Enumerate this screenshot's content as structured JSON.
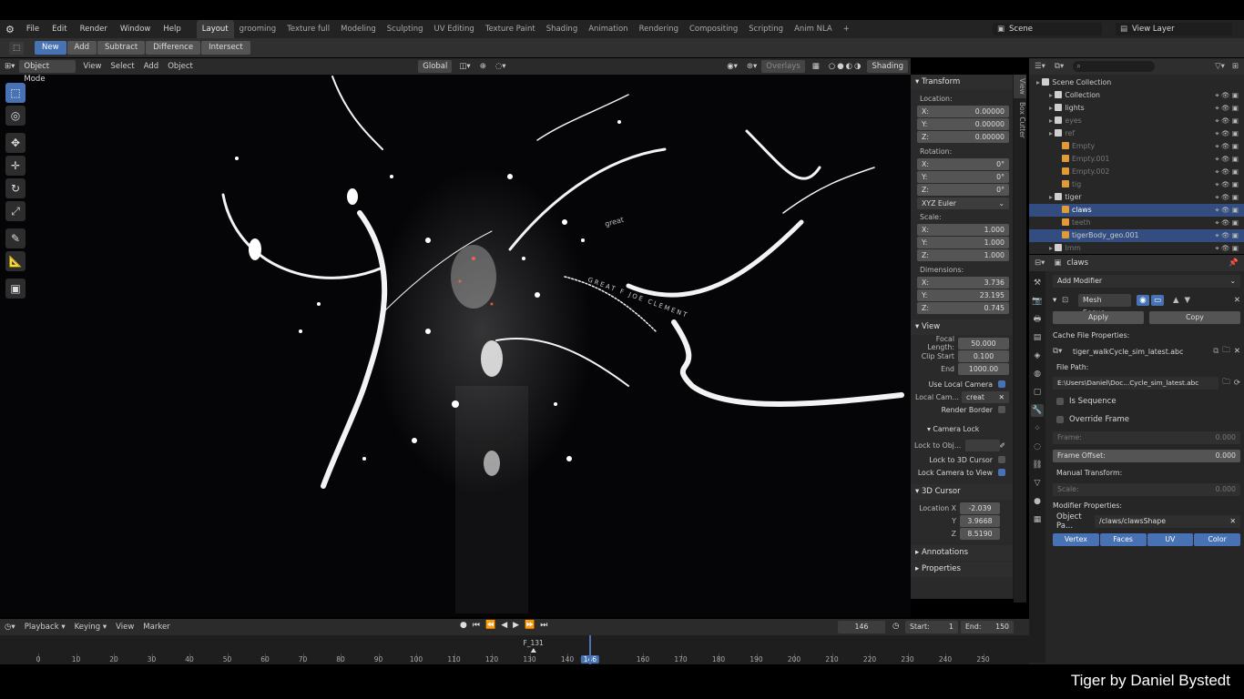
{
  "menu": {
    "items": [
      "File",
      "Edit",
      "Render",
      "Window",
      "Help"
    ],
    "workspaces": [
      "Layout",
      "grooming",
      "Texture full",
      "Modeling",
      "Sculpting",
      "UV Editing",
      "Texture Paint",
      "Shading",
      "Animation",
      "Rendering",
      "Compositing",
      "Scripting",
      "Anim NLA"
    ],
    "active_workspace": "Layout",
    "add_tab": "+",
    "scene": "Scene",
    "view_layer": "View Layer"
  },
  "tool_header": {
    "new": "New",
    "add": "Add",
    "subtract": "Subtract",
    "difference": "Difference",
    "intersect": "Intersect"
  },
  "viewport_header": {
    "mode": "Object Mode",
    "view": "View",
    "select": "Select",
    "add": "Add",
    "object": "Object",
    "transform_orientation": "Global",
    "overlays": "Overlays",
    "shading": "Shading"
  },
  "viewport_text": {
    "text1": "great",
    "text2": "GREAT F JOE CLEMENT"
  },
  "npanel": {
    "transform": "Transform",
    "location_label": "Location:",
    "location": [
      {
        "axis": "X:",
        "value": "0.00000"
      },
      {
        "axis": "Y:",
        "value": "0.00000"
      },
      {
        "axis": "Z:",
        "value": "0.00000"
      }
    ],
    "rotation_label": "Rotation:",
    "rotation": [
      {
        "axis": "X:",
        "value": "0°"
      },
      {
        "axis": "Y:",
        "value": "0°"
      },
      {
        "axis": "Z:",
        "value": "0°"
      }
    ],
    "rotation_mode": "XYZ Euler",
    "scale_label": "Scale:",
    "scale": [
      {
        "axis": "X:",
        "value": "1.000"
      },
      {
        "axis": "Y:",
        "value": "1.000"
      },
      {
        "axis": "Z:",
        "value": "1.000"
      }
    ],
    "dimensions_label": "Dimensions:",
    "dimensions": [
      {
        "axis": "X:",
        "value": "3.736"
      },
      {
        "axis": "Y:",
        "value": "23.195"
      },
      {
        "axis": "Z:",
        "value": "0.745"
      }
    ],
    "view": "View",
    "focal_length_label": "Focal Length:",
    "focal_length": "50.000",
    "clip_start_label": "Clip Start",
    "clip_start": "0.100",
    "end_label": "End",
    "end": "1000.00",
    "use_local_camera": "Use Local Camera",
    "local_cam_label": "Local Cam...",
    "local_cam_value": "creat",
    "render_border": "Render Border",
    "camera_lock": "Camera Lock",
    "lock_to_obj": "Lock to Obj...",
    "lock_3d_cursor": "Lock to 3D Cursor",
    "lock_camera_view": "Lock Camera to View",
    "cursor": "3D Cursor",
    "cursor_location_label": "Location X",
    "cursor_x": "-2.039",
    "cursor_y_label": "Y",
    "cursor_y": "3.9668",
    "cursor_z_label": "Z",
    "cursor_z": "8.5190",
    "annotations": "Annotations",
    "properties": "Properties",
    "tabs": [
      "View",
      "Box Cutter"
    ]
  },
  "outliner": {
    "rows": [
      {
        "label": "Scene Collection",
        "indent": 0
      },
      {
        "label": "Collection",
        "indent": 1
      },
      {
        "label": "lights",
        "indent": 1
      },
      {
        "label": "eyes",
        "indent": 1,
        "dim": true
      },
      {
        "label": "ref",
        "indent": 1,
        "dim": true
      },
      {
        "label": "Empty",
        "indent": 2,
        "dim": true
      },
      {
        "label": "Empty.001",
        "indent": 2,
        "dim": true
      },
      {
        "label": "Empty.002",
        "indent": 2,
        "dim": true
      },
      {
        "label": "tig",
        "indent": 2,
        "dim": true
      },
      {
        "label": "tiger",
        "indent": 1
      },
      {
        "label": "claws",
        "indent": 2,
        "bright": true
      },
      {
        "label": "teeth",
        "indent": 2,
        "dim": true
      },
      {
        "label": "tigerBody_geo.001",
        "indent": 2
      },
      {
        "label": "Imm",
        "indent": 1,
        "dim": true
      }
    ]
  },
  "properties": {
    "object": "claws",
    "add_modifier": "Add Modifier",
    "modifier_name": "Mesh Seque...",
    "apply": "Apply",
    "copy": "Copy",
    "cache_file_props": "Cache File Properties:",
    "cache_file": "tiger_walkCycle_sim_latest.abc",
    "file_path_label": "File Path:",
    "file_path": "E:\\Users\\Daniel\\Doc...Cycle_sim_latest.abc",
    "is_sequence": "Is Sequence",
    "override_frame": "Override Frame",
    "frame_label": "Frame:",
    "frame_value": "0.000",
    "frame_offset_label": "Frame Offset:",
    "frame_offset_value": "0.000",
    "manual_transform": "Manual Transform:",
    "scale_label": "Scale:",
    "scale_value": "0.000",
    "modifier_props": "Modifier Properties:",
    "object_path_label": "Object Pa...",
    "object_path": "/claws/clawsShape",
    "channels": [
      "Vertex",
      "Faces",
      "UV",
      "Color"
    ]
  },
  "timeline": {
    "playback": "Playback",
    "keying": "Keying",
    "view": "View",
    "marker": "Marker",
    "current_frame": "146",
    "start_label": "Start:",
    "start": "1",
    "end_label": "End:",
    "end": "150",
    "marker_name": "F_131",
    "ticks": [
      "0",
      "10",
      "20",
      "30",
      "40",
      "50",
      "60",
      "70",
      "80",
      "90",
      "100",
      "110",
      "120",
      "130",
      "140",
      "146",
      "160",
      "170",
      "180",
      "190",
      "200",
      "210",
      "220",
      "230",
      "240",
      "250"
    ],
    "tick_frames": [
      0,
      10,
      20,
      30,
      40,
      50,
      60,
      70,
      80,
      90,
      100,
      110,
      120,
      130,
      140,
      146,
      160,
      170,
      180,
      190,
      200,
      210,
      220,
      230,
      240,
      250
    ],
    "current_frame_number": 146,
    "marker_frame": 131
  },
  "caption": "Tiger by Daniel Bystedt",
  "colors": {
    "accent": "#4772b3",
    "orange": "#e09a3a",
    "bg": "#050507"
  }
}
